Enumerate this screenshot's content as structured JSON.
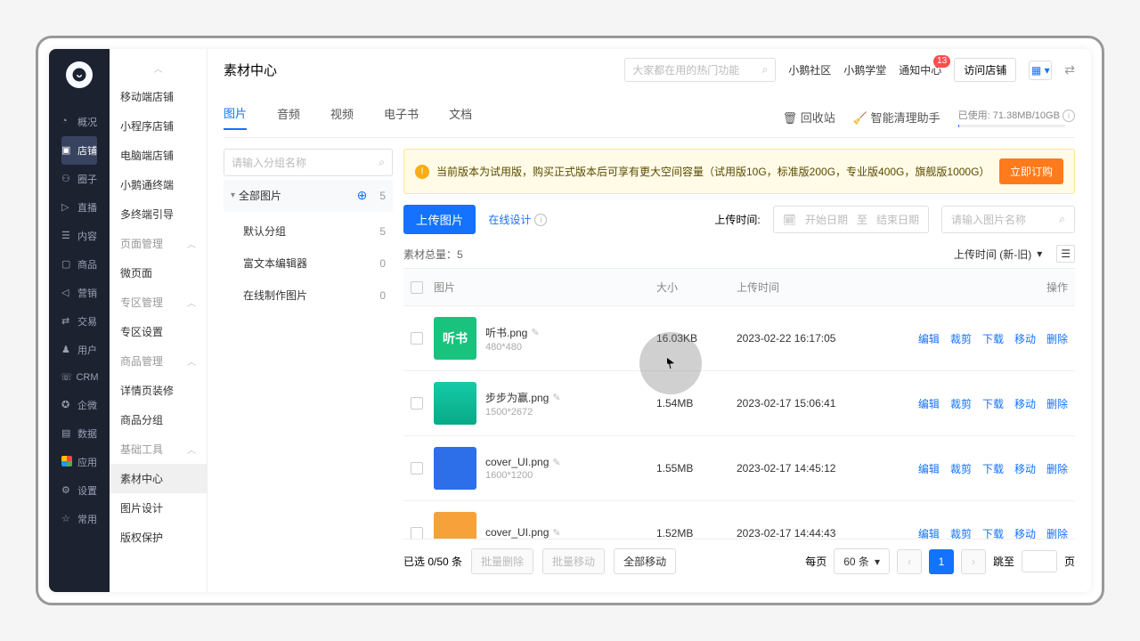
{
  "nav": {
    "items": [
      {
        "label": "概况",
        "icon": "clock"
      },
      {
        "label": "店铺",
        "icon": "store",
        "active": true
      },
      {
        "label": "圈子",
        "icon": "users"
      },
      {
        "label": "直播",
        "icon": "video"
      },
      {
        "label": "内容",
        "icon": "doc"
      },
      {
        "label": "商品",
        "icon": "bag"
      },
      {
        "label": "营销",
        "icon": "horn"
      },
      {
        "label": "交易",
        "icon": "swap"
      },
      {
        "label": "用户",
        "icon": "user"
      },
      {
        "label": "CRM",
        "icon": "crm"
      },
      {
        "label": "企微",
        "icon": "wechat"
      },
      {
        "label": "数据",
        "icon": "chart"
      },
      {
        "label": "应用",
        "icon": "apps"
      },
      {
        "label": "设置",
        "icon": "gear"
      },
      {
        "label": "常用",
        "icon": "star"
      }
    ]
  },
  "subnav": {
    "groups": [
      {
        "header": "",
        "items": [
          {
            "label": "移动端店铺"
          },
          {
            "label": "小程序店铺"
          },
          {
            "label": "电脑端店铺"
          },
          {
            "label": "小鹅通终端"
          },
          {
            "label": "多终端引导"
          }
        ],
        "chev": true
      },
      {
        "header": "页面管理",
        "items": [
          {
            "label": "微页面"
          }
        ]
      },
      {
        "header": "专区管理",
        "items": [
          {
            "label": "专区设置"
          }
        ]
      },
      {
        "header": "商品管理",
        "items": [
          {
            "label": "详情页装修"
          },
          {
            "label": "商品分组"
          }
        ]
      },
      {
        "header": "基础工具",
        "items": [
          {
            "label": "素材中心",
            "active": true
          },
          {
            "label": "图片设计"
          },
          {
            "label": "版权保护"
          }
        ]
      }
    ]
  },
  "header": {
    "title": "素材中心",
    "search_placeholder": "大家都在用的热门功能",
    "links": [
      "小鹅社区",
      "小鹅学堂",
      "通知中心"
    ],
    "badge": "13",
    "visit": "访问店铺"
  },
  "tabs": {
    "items": [
      "图片",
      "音频",
      "视频",
      "电子书",
      "文档"
    ],
    "active": 0,
    "recycle": "回收站",
    "cleaner": "智能清理助手",
    "usage_label": "已使用: 71.38MB/10GB"
  },
  "folders": {
    "placeholder": "请输入分组名称",
    "all": {
      "label": "全部图片",
      "count": "5"
    },
    "list": [
      {
        "label": "默认分组",
        "count": "5"
      },
      {
        "label": "富文本编辑器",
        "count": "0"
      },
      {
        "label": "在线制作图片",
        "count": "0"
      }
    ]
  },
  "notice": {
    "text": "当前版本为试用版，购买正式版本后可享有更大空间容量（试用版10G，标准版200G，专业版400G，旗舰版1000G）",
    "btn": "立即订购"
  },
  "toolbar": {
    "upload": "上传图片",
    "design": "在线设计",
    "time_label": "上传时间:",
    "date_start": "开始日期",
    "date_to": "至",
    "date_end": "结束日期",
    "filter_placeholder": "请输入图片名称"
  },
  "meta": {
    "total": "素材总量：5",
    "sort": "上传时间 (新-旧)"
  },
  "table": {
    "headers": {
      "img": "图片",
      "size": "大小",
      "time": "上传时间",
      "act": "操作"
    },
    "actions": [
      "编辑",
      "裁剪",
      "下载",
      "移动",
      "删除"
    ],
    "rows": [
      {
        "name": "听书.png",
        "dim": "480*480",
        "size": "16.03KB",
        "time": "2023-02-22 16:17:05",
        "thumbText": "听书",
        "thumbClass": "t1"
      },
      {
        "name": "步步为赢.png",
        "dim": "1500*2672",
        "size": "1.54MB",
        "time": "2023-02-17 15:06:41",
        "thumbClass": "t2"
      },
      {
        "name": "cover_UI.png",
        "dim": "1600*1200",
        "size": "1.55MB",
        "time": "2023-02-17 14:45:12",
        "thumbClass": "t3"
      },
      {
        "name": "cover_UI.png",
        "dim": "",
        "size": "1.52MB",
        "time": "2023-02-17 14:44:43",
        "thumbClass": "t4"
      }
    ]
  },
  "footer": {
    "selected": "已选 0/50 条",
    "batch_delete": "批量删除",
    "batch_move": "批量移动",
    "move_all": "全部移动",
    "per_page": "每页",
    "per_page_val": "60 条",
    "jump": "跳至",
    "page_unit": "页",
    "current": "1"
  }
}
